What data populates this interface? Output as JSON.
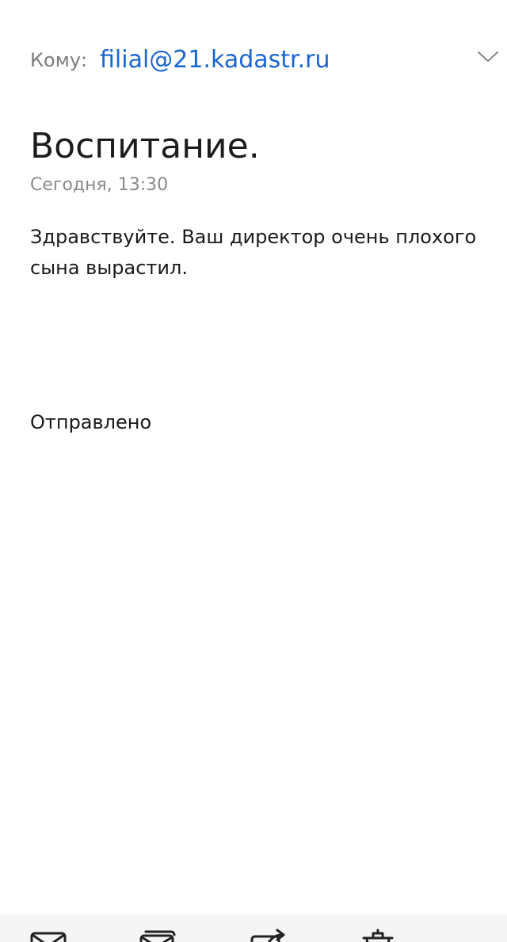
{
  "header": {
    "to_label": "Кому:",
    "to_address": "filial@21.kadastr.ru",
    "chevron_icon": "chevron-down-icon"
  },
  "message": {
    "subject": "Воспитание.",
    "date": "Сегодня, 13:30",
    "body": "Здравствуйте. Ваш директор очень плохого сына вырастил.",
    "signature": "Отправлено"
  },
  "toolbar": {
    "icons": [
      "mail-icon",
      "mark-unread-icon",
      "forward-icon",
      "delete-icon",
      "more-icon"
    ]
  },
  "colors": {
    "accent": "#1a66d1",
    "muted": "#7b7b7b",
    "text": "#1a1a1a",
    "toolbar_bg": "#f5f5f5"
  }
}
